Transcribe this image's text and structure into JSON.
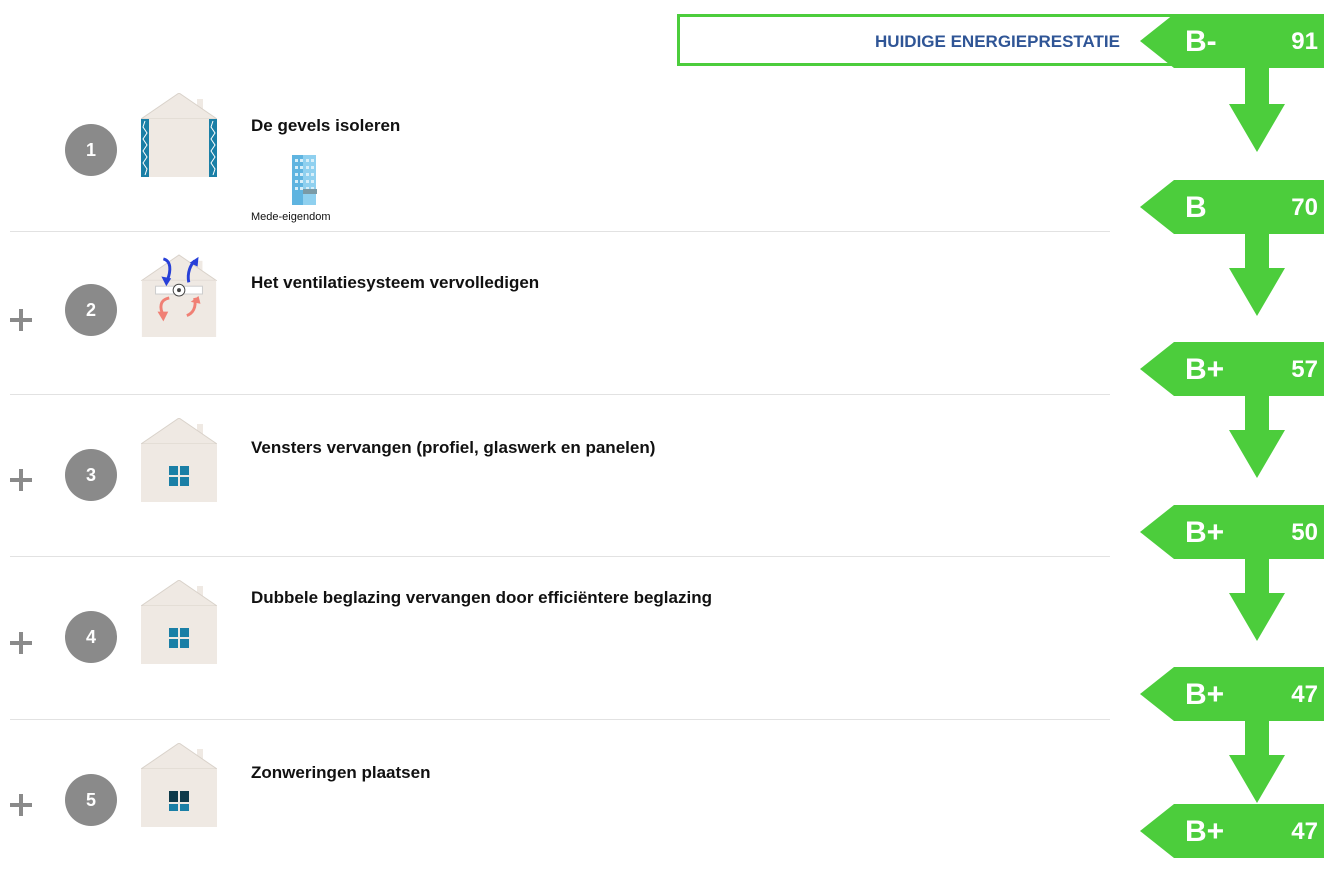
{
  "header": {
    "title": "HUIDIGE ENERGIEPRESTATIE"
  },
  "labels": [
    {
      "letter": "B-",
      "score": "91"
    },
    {
      "letter": "B",
      "score": "70"
    },
    {
      "letter": "B+",
      "score": "57"
    },
    {
      "letter": "B+",
      "score": "50"
    },
    {
      "letter": "B+",
      "score": "47"
    },
    {
      "letter": "B+",
      "score": "47"
    }
  ],
  "measures": [
    {
      "number": "1",
      "title": "De gevels isoleren",
      "icon": "house-insulated-walls-icon",
      "sub_label": "Mede-eigendom",
      "sub_icon": "building-icon"
    },
    {
      "number": "2",
      "title": "Het ventilatiesysteem vervolledigen",
      "icon": "house-ventilation-icon"
    },
    {
      "number": "3",
      "title": "Vensters vervangen (profiel, glaswerk en panelen)",
      "icon": "house-window-icon"
    },
    {
      "number": "4",
      "title": "Dubbele beglazing vervangen door efficiëntere beglazing",
      "icon": "house-window-icon"
    },
    {
      "number": "5",
      "title": "Zonweringen plaatsen",
      "icon": "house-shaded-window-icon"
    }
  ],
  "colors": {
    "label_green": "#4ccd3c",
    "header_text": "#2f5596",
    "circle_grey": "#8a8a8a",
    "window_blue": "#1a7fa6",
    "house_wall": "#efe9e3"
  }
}
